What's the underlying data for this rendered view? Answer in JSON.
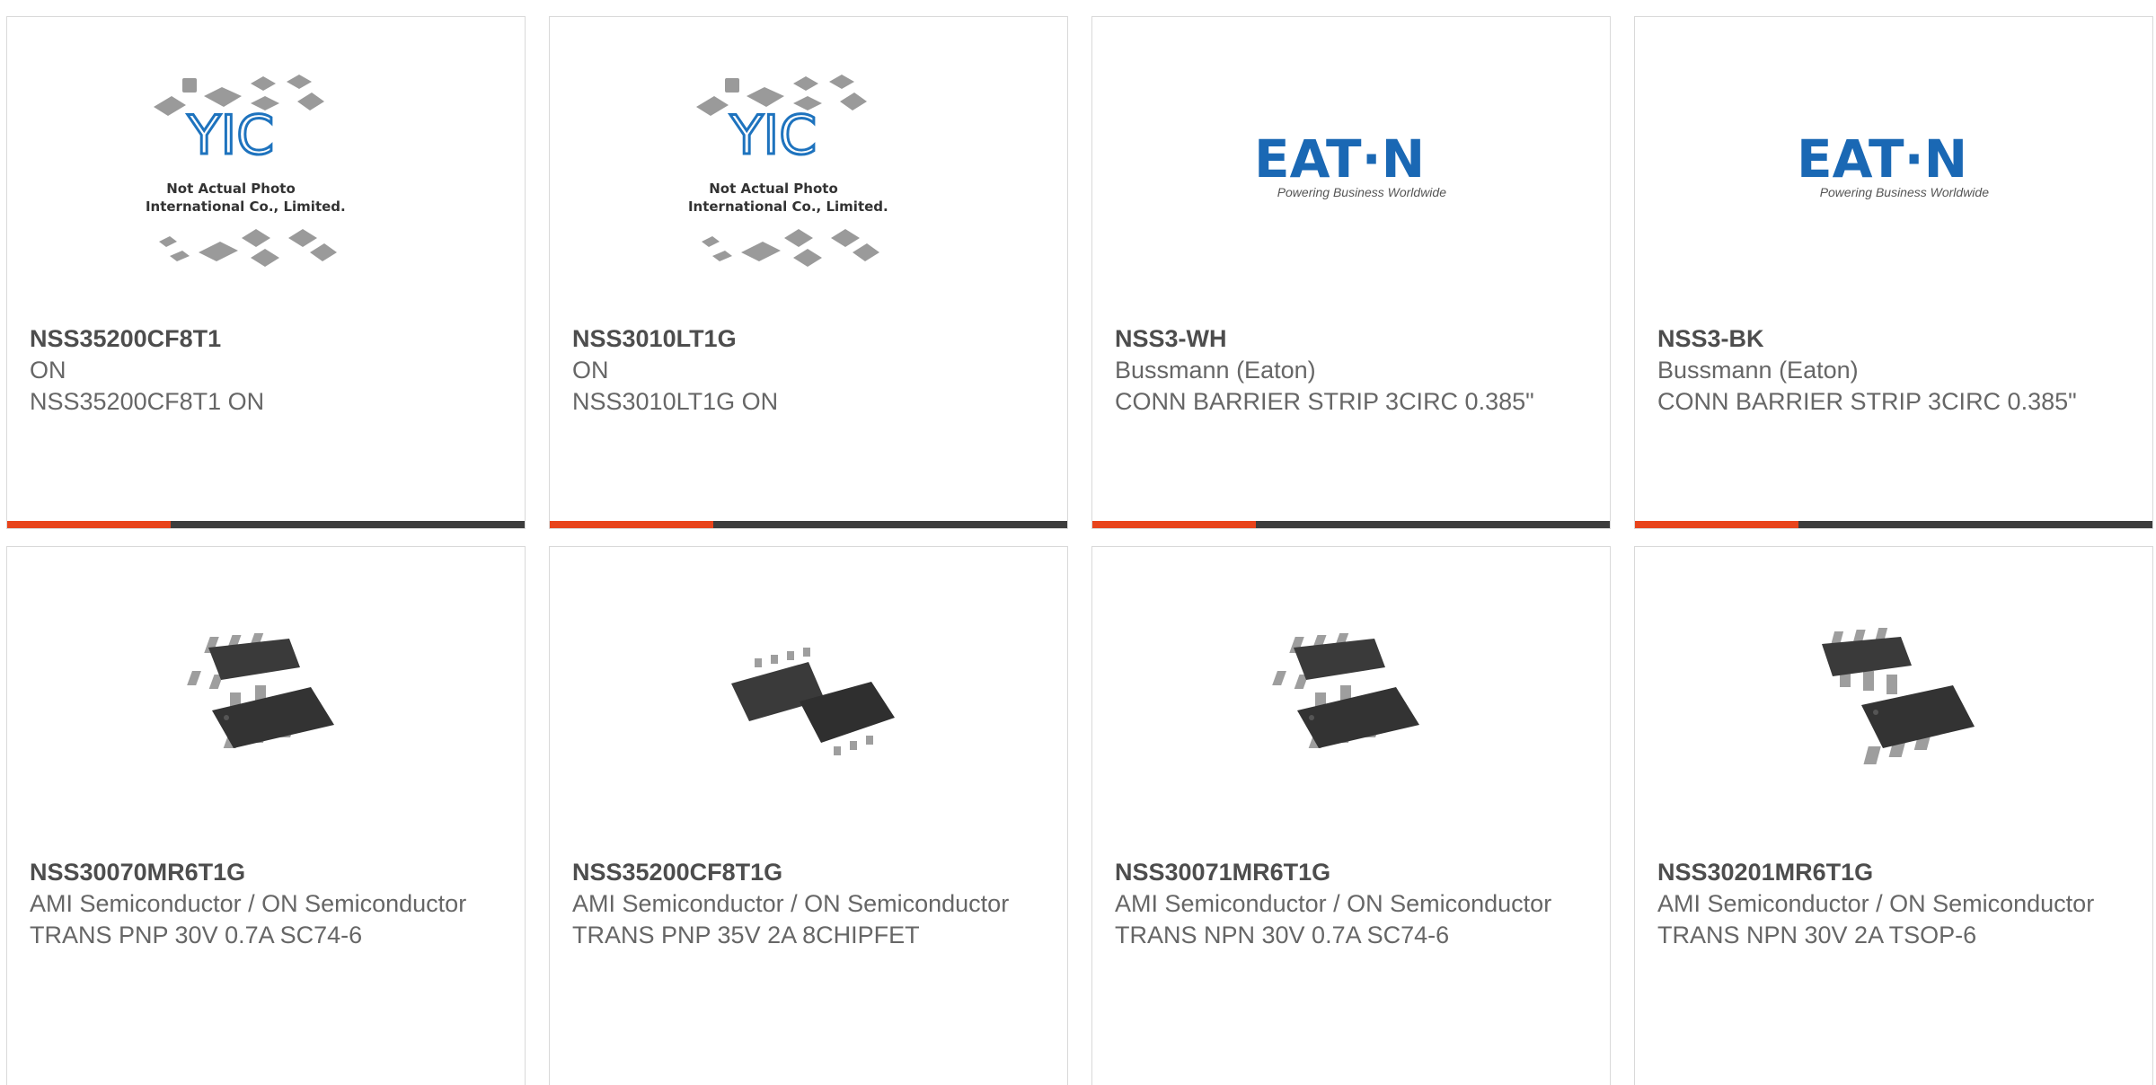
{
  "accent_color": "#e8441c",
  "products": [
    {
      "image": "yic-placeholder-photo",
      "name": "NSS35200CF8T1",
      "manufacturer": "ON",
      "description": "NSS35200CF8T1 ON"
    },
    {
      "image": "yic-placeholder-photo",
      "name": "NSS3010LT1G",
      "manufacturer": "ON",
      "description": "NSS3010LT1G ON"
    },
    {
      "image": "eaton-logo",
      "name": "NSS3-WH",
      "manufacturer": "Bussmann (Eaton)",
      "description": "CONN BARRIER STRIP 3CIRC 0.385\""
    },
    {
      "image": "eaton-logo",
      "name": "NSS3-BK",
      "manufacturer": "Bussmann (Eaton)",
      "description": "CONN BARRIER STRIP 3CIRC 0.385\""
    },
    {
      "image": "sc74-6-chip-photo",
      "name": "NSS30070MR6T1G",
      "manufacturer": "AMI Semiconductor / ON Semiconductor",
      "description": "TRANS PNP 30V 0.7A SC74-6"
    },
    {
      "image": "chipfet-8-chip-photo",
      "name": "NSS35200CF8T1G",
      "manufacturer": "AMI Semiconductor / ON Semiconductor",
      "description": "TRANS PNP 35V 2A 8CHIPFET"
    },
    {
      "image": "sc74-6-chip-photo",
      "name": "NSS30071MR6T1G",
      "manufacturer": "AMI Semiconductor / ON Semiconductor",
      "description": "TRANS NPN 30V 0.7A SC74-6"
    },
    {
      "image": "tsop-6-chip-photo",
      "name": "NSS30201MR6T1G",
      "manufacturer": "AMI Semiconductor / ON Semiconductor",
      "description": "TRANS NPN 30V 2A TSOP-6"
    }
  ],
  "yic_logo": {
    "mark": "YIC",
    "caption_line1": "Not Actual Photo",
    "caption_line2": "YIC International Co., Limited."
  },
  "eaton_logo": {
    "wordmark": "EAT·N",
    "tagline": "Powering Business Worldwide",
    "color": "#1a68b4"
  }
}
